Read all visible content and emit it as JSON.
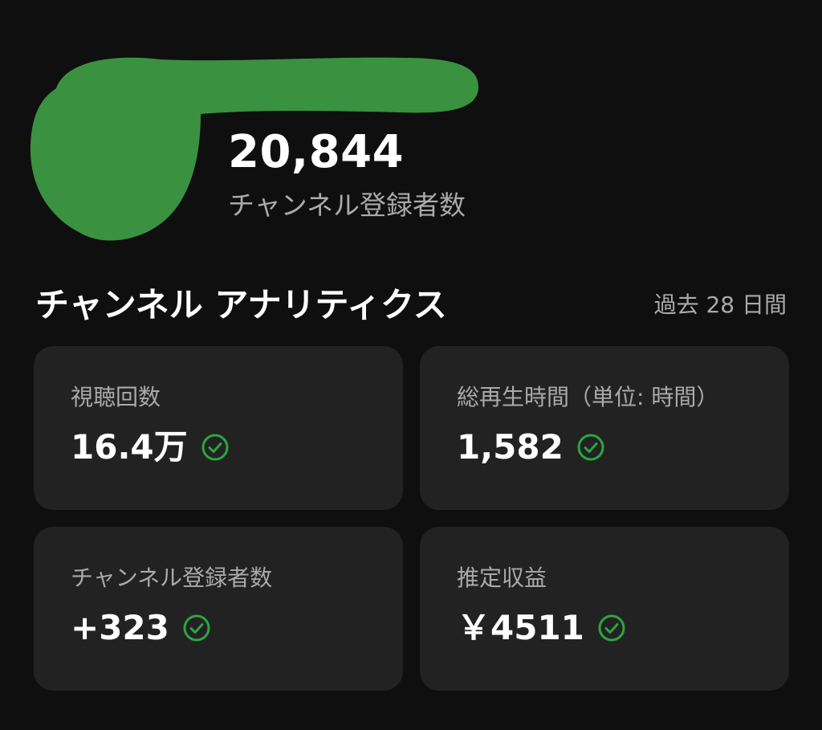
{
  "header": {
    "subscriber_count": "20,844",
    "subscriber_label": "チャンネル登録者数",
    "redaction_color": "#3a9140"
  },
  "analytics": {
    "title": "チャンネル アナリティクス",
    "period": "過去 28 日間",
    "check_color": "#2ba640",
    "cards": [
      {
        "label": "視聴回数",
        "value": "16.4万",
        "status_icon": "check-circle-icon"
      },
      {
        "label": "総再生時間（単位: 時間）",
        "value": "1,582",
        "status_icon": "check-circle-icon"
      },
      {
        "label": "チャンネル登録者数",
        "value": "+323",
        "status_icon": "check-circle-icon"
      },
      {
        "label": "推定収益",
        "value": "￥4511",
        "status_icon": "check-circle-icon"
      }
    ]
  }
}
